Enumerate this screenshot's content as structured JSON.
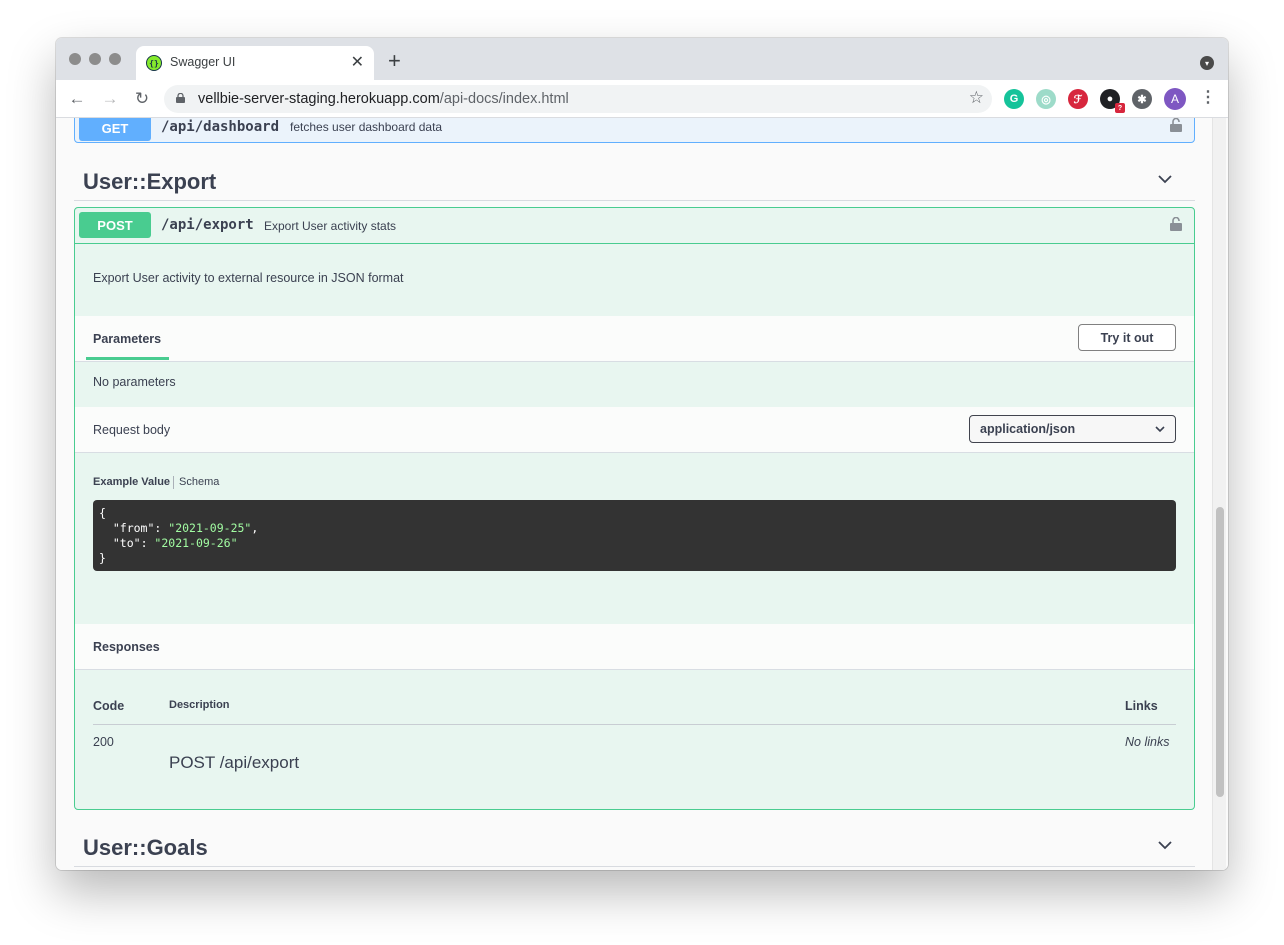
{
  "browser": {
    "tab_title": "Swagger UI",
    "new_tab": "+",
    "url_host": "vellbie-server-staging.herokuapp.com",
    "url_path": "/api-docs/index.html"
  },
  "extensions": [
    {
      "name": "grammarly-icon",
      "color": "#15c39a",
      "glyph": "G"
    },
    {
      "name": "extension-target-icon",
      "color": "#9ddbc9",
      "glyph": "◎"
    },
    {
      "name": "extension-red-icon",
      "color": "#d7263d",
      "glyph": "ℱ"
    },
    {
      "name": "github-icon",
      "color": "#202124",
      "glyph": "●",
      "badge": "?"
    },
    {
      "name": "puzzle-icon",
      "color": "#5f6368",
      "glyph": "✱"
    }
  ],
  "profile_initial": "A",
  "swagger": {
    "get_op": {
      "method": "GET",
      "path": "/api/dashboard",
      "summary": "fetches user dashboard data"
    },
    "tag_export": "User::Export",
    "post_op": {
      "method": "POST",
      "path": "/api/export",
      "summary": "Export User activity stats",
      "description": "Export User activity to external resource in JSON format",
      "parameters_tab": "Parameters",
      "try_button": "Try it out",
      "no_parameters": "No parameters",
      "request_body_label": "Request body",
      "content_type": "application/json",
      "example_tab": "Example Value",
      "schema_tab": "Schema",
      "example": {
        "open": "{",
        "from_key": "\"from\"",
        "from_value": "\"2021-09-25\"",
        "to_key": "\"to\"",
        "to_value": "\"2021-09-26\"",
        "close": "}"
      },
      "responses_title": "Responses",
      "table_headers": {
        "code": "Code",
        "description": "Description",
        "links": "Links"
      },
      "responses": [
        {
          "code": "200",
          "description": "POST /api/export",
          "links": "No links"
        }
      ]
    },
    "tag_goals": "User::Goals"
  }
}
